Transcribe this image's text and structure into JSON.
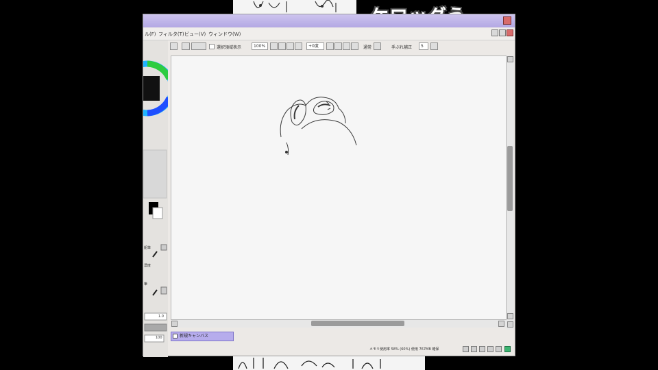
{
  "overlay": {
    "title": "ケロッグう"
  },
  "menu": {
    "items": [
      "ル(F)",
      "フィルタ(T)",
      "ビュー(V)",
      "ウィンドウ(W)"
    ]
  },
  "toolbar": {
    "select_source_label": "選択領域表示",
    "zoom_value": "100%",
    "rotation_value": "+0度",
    "mode_label": "通常",
    "stabilizer_label": "手ぶれ補正",
    "stabilizer_value": "5"
  },
  "left_panel": {
    "texts": [
      "鉛筆",
      "濃度",
      "筆",
      "1.0",
      "100"
    ]
  },
  "document_tab": {
    "label": "新規キャンバス"
  },
  "status": {
    "text": "メモリ使用率 58% (60%) 使用 767MB 確保"
  },
  "colors": {
    "titlebar": "#b6acec",
    "canvas": "#f6f6f6",
    "active_tab": "#b6acec",
    "close_button": "#d86b6b"
  },
  "icons": [
    "color-wheel-icon",
    "close-icon",
    "maximize-icon",
    "minimize-icon",
    "scroll-arrow-icon",
    "pencil-icon",
    "checkbox-icon"
  ]
}
